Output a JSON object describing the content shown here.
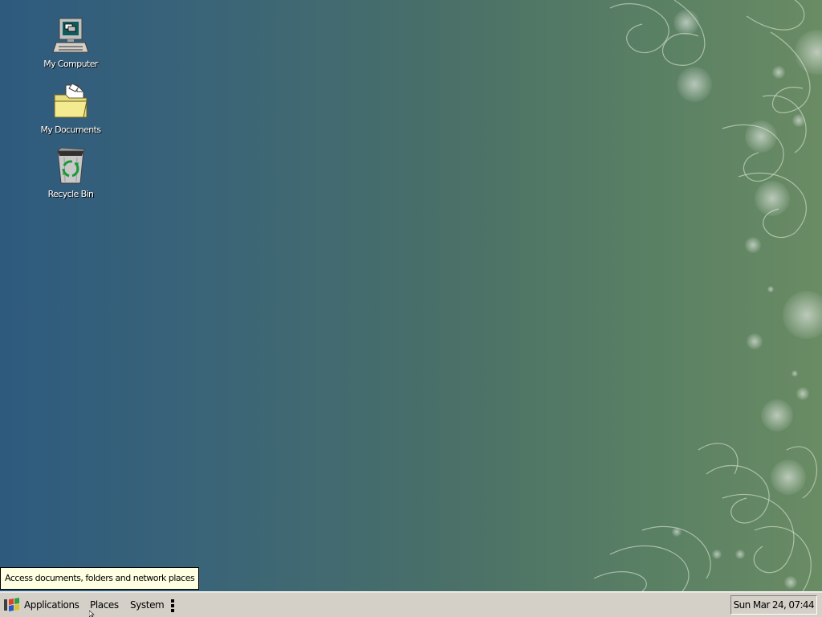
{
  "desktop": {
    "icons": [
      {
        "label": "My Computer",
        "icon": "computer-icon"
      },
      {
        "label": "My Documents",
        "icon": "folder-icon"
      },
      {
        "label": "Recycle Bin",
        "icon": "recycle-bin-icon"
      }
    ]
  },
  "tooltip": {
    "text": "Access documents, folders and network places"
  },
  "taskbar": {
    "menus": [
      {
        "label": "Applications",
        "icon": "windows-logo-icon"
      },
      {
        "label": "Places"
      },
      {
        "label": "System"
      }
    ],
    "clock": "Sun Mar 24, 07:44"
  },
  "colors": {
    "desktop_left": "#2e5a7e",
    "desktop_right": "#6a8c64",
    "taskbar": "#d4d0c8",
    "tooltip_bg": "#ffffe1"
  }
}
